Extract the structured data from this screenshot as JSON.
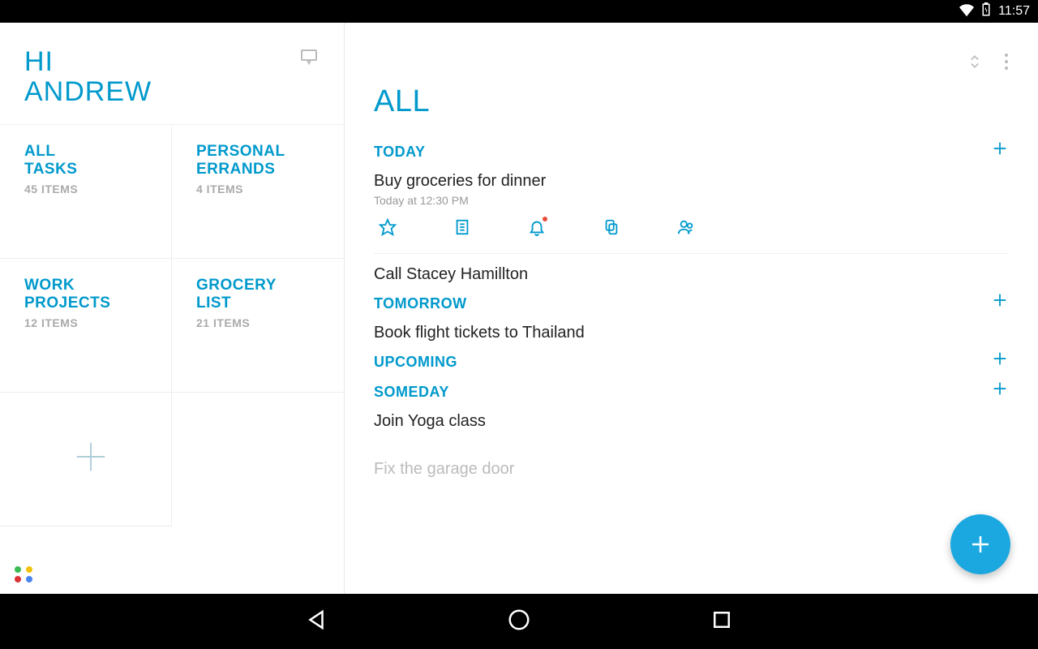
{
  "status": {
    "time": "11:57"
  },
  "sidebar": {
    "greeting_line1": "HI",
    "greeting_line2": "ANDREW",
    "tiles": [
      {
        "title_l1": "ALL",
        "title_l2": "TASKS",
        "sub": "45 ITEMS"
      },
      {
        "title_l1": "PERSONAL",
        "title_l2": "ERRANDS",
        "sub": "4 ITEMS"
      },
      {
        "title_l1": "WORK",
        "title_l2": "PROJECTS",
        "sub": "12 ITEMS"
      },
      {
        "title_l1": "GROCERY",
        "title_l2": "LIST",
        "sub": "21 ITEMS"
      }
    ]
  },
  "main": {
    "title": "ALL",
    "sections": {
      "today": {
        "label": "TODAY"
      },
      "tomorrow": {
        "label": "TOMORROW"
      },
      "upcoming": {
        "label": "UPCOMING"
      },
      "someday": {
        "label": "SOMEDAY"
      }
    },
    "tasks": {
      "t1": {
        "title": "Buy groceries for dinner",
        "sub": "Today at 12:30 PM"
      },
      "t2": {
        "title": "Call Stacey Hamillton"
      },
      "t3": {
        "title": "Book flight tickets to Thailand"
      },
      "t4": {
        "title": "Join Yoga class"
      },
      "t5": {
        "title": "Fix the garage door"
      }
    }
  },
  "colors": {
    "accent": "#0099cc",
    "fab": "#1ba8e0",
    "logo": [
      "#3cba54",
      "#f4c20d",
      "#db3236",
      "#4885ed"
    ]
  }
}
